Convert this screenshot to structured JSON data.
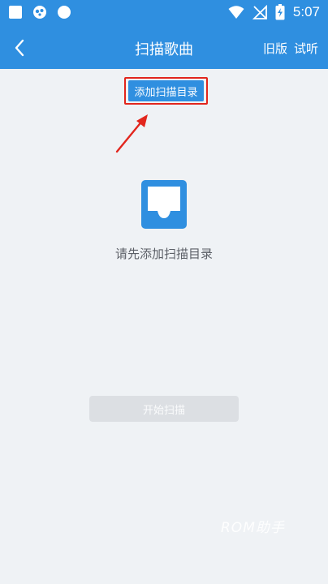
{
  "status_bar": {
    "time": "5:07",
    "left_icons": [
      "square-icon",
      "notification-icon",
      "circle-icon"
    ],
    "right_icons": [
      "wifi-icon",
      "no-signal-icon",
      "battery-charging-icon"
    ]
  },
  "header": {
    "title": "扫描歌曲",
    "actions": [
      "旧版",
      "试听"
    ],
    "back_icon": "chevron-left-icon",
    "background": "#2f8fe0"
  },
  "main": {
    "add_dir_label": "添加扫描目录",
    "empty_icon": "inbox-icon",
    "empty_text": "请先添加扫描目录",
    "start_label": "开始扫描"
  },
  "watermark": "ROM助手",
  "colors": {
    "accent": "#2f8fe0",
    "highlight": "#e2261d",
    "background": "#eff2f5",
    "disabled_button": "#dcdfe3"
  }
}
